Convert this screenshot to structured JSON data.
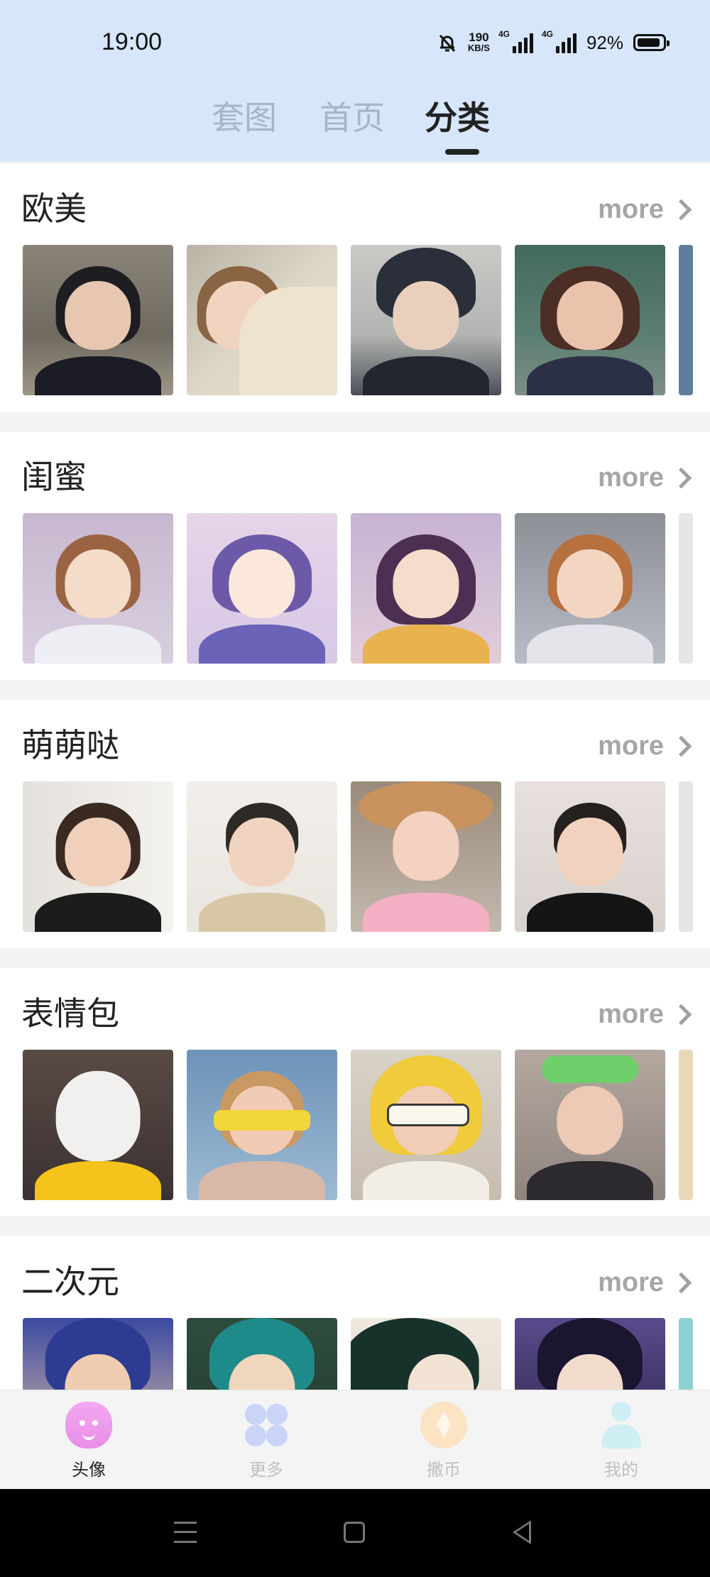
{
  "status_bar": {
    "time": "19:00",
    "net_speed_value": "190",
    "net_speed_unit": "KB/S",
    "signal1_label": "4G",
    "signal2_label": "4G",
    "battery_pct": "92%",
    "icons": [
      "bell-muted-icon",
      "signal-icon",
      "signal-icon",
      "battery-icon"
    ]
  },
  "tabs": [
    {
      "label": "套图",
      "active": false
    },
    {
      "label": "首页",
      "active": false
    },
    {
      "label": "分类",
      "active": true
    }
  ],
  "sections": [
    {
      "title": "欧美",
      "more": "more",
      "thumbs": [
        "photo-woman-beret-dove",
        "photo-woman-fan",
        "photo-woman-helmet",
        "photo-woman-wind-hair"
      ]
    },
    {
      "title": "闺蜜",
      "more": "more",
      "thumbs": [
        "anime-girl-sailor",
        "anime-girl-purple",
        "anime-girl-icecream",
        "anime-girl-ponytail"
      ]
    },
    {
      "title": "萌萌哒",
      "more": "more",
      "thumbs": [
        "photo-toddler-girl",
        "photo-toddler-glasses",
        "photo-girl-hat",
        "photo-boy-mohawk"
      ]
    },
    {
      "title": "表情包",
      "more": "more",
      "thumbs": [
        "photo-face-mask",
        "photo-kid-sunglasses",
        "photo-girl-yellow-hood",
        "photo-boy-balloon-hat"
      ]
    },
    {
      "title": "二次元",
      "more": "more",
      "thumbs": [
        "anime-blue-hair",
        "anime-green-hair",
        "anime-dark-hair",
        "anime-purple-hair"
      ]
    }
  ],
  "bottom_nav": [
    {
      "label": "头像",
      "icon": "avatar-face-icon",
      "active": true
    },
    {
      "label": "更多",
      "icon": "four-petal-icon",
      "active": false
    },
    {
      "label": "撒币",
      "icon": "coin-star-icon",
      "active": false
    },
    {
      "label": "我的",
      "icon": "person-icon",
      "active": false
    }
  ],
  "system_nav": [
    "menu-icon",
    "home-icon",
    "back-icon"
  ],
  "colors": {
    "header_bg": "#d7e6fb",
    "tab_inactive": "#a8b5c6",
    "more_gray": "#a6a6a6",
    "nav_active": "#f0a6ec"
  }
}
